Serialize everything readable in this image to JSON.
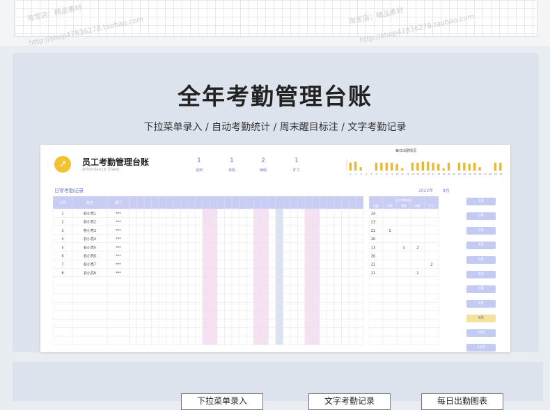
{
  "banner": {
    "title": "全年考勤管理台账",
    "subtitle": "下拉菜单录入 / 自动考勤统计 / 周末醒目标注 / 文字考勤记录"
  },
  "watermarks": [
    "淘宝店：精品素材",
    "http://shop47836278.taobao.com"
  ],
  "sheet": {
    "title": "员工考勤管理台账",
    "subtitle": "Attendance Sheet",
    "stats": [
      {
        "value": "1",
        "label": "迟到"
      },
      {
        "value": "1",
        "label": "事假"
      },
      {
        "value": "2",
        "label": "病假"
      },
      {
        "value": "1",
        "label": "旷工"
      }
    ],
    "chart_title": "每日出勤情况",
    "section_title": "日常考勤记录",
    "year": "2022年",
    "month": "9月",
    "columns": [
      "工号",
      "姓名",
      "部门"
    ],
    "summary_title": "全月考勤统计",
    "summary_cols": [
      "出勤",
      "迟到",
      "事假",
      "病假",
      "旷工"
    ],
    "rows": [
      {
        "id": "1",
        "name": "初小亮1",
        "dept": "***",
        "att": "24",
        "lt": "",
        "sj": "",
        "bj": "",
        "kg": ""
      },
      {
        "id": "2",
        "name": "初小亮2",
        "dept": "***",
        "att": "23",
        "lt": "",
        "sj": "",
        "bj": "",
        "kg": ""
      },
      {
        "id": "3",
        "name": "初小亮3",
        "dept": "***",
        "att": "21",
        "lt": "1",
        "sj": "",
        "bj": "",
        "kg": ""
      },
      {
        "id": "4",
        "name": "初小亮4",
        "dept": "***",
        "att": "20",
        "lt": "",
        "sj": "",
        "bj": "",
        "kg": ""
      },
      {
        "id": "5",
        "name": "初小亮5",
        "dept": "***",
        "att": "13",
        "lt": "",
        "sj": "1",
        "bj": "2",
        "kg": ""
      },
      {
        "id": "6",
        "name": "初小亮6",
        "dept": "***",
        "att": "20",
        "lt": "",
        "sj": "",
        "bj": "",
        "kg": ""
      },
      {
        "id": "7",
        "name": "初小亮7",
        "dept": "***",
        "att": "21",
        "lt": "",
        "sj": "",
        "bj": "",
        "kg": "2"
      },
      {
        "id": "8",
        "name": "初小亮8",
        "dept": "***",
        "att": "21",
        "lt": "",
        "sj": "",
        "bj": "1",
        "kg": ""
      }
    ],
    "months": [
      "1月",
      "2月",
      "3月",
      "4月",
      "5月",
      "6月",
      "7月",
      "8月",
      "9月",
      "10月",
      "11月"
    ],
    "selected_month": "9月"
  },
  "chart_data": {
    "type": "bar",
    "title": "每日出勤情况",
    "categories": [
      "1",
      "2",
      "3",
      "4",
      "5",
      "6",
      "7",
      "8",
      "9",
      "10",
      "11",
      "12",
      "13",
      "14",
      "15",
      "16",
      "17",
      "18",
      "19",
      "20",
      "21",
      "22",
      "23",
      "24",
      "25",
      "26",
      "27",
      "28",
      "29",
      "30"
    ],
    "values": [
      7,
      8,
      3,
      0,
      0,
      7,
      7,
      7,
      7,
      6,
      2,
      0,
      7,
      7,
      8,
      8,
      7,
      6,
      2,
      7,
      0,
      7,
      7,
      6,
      7,
      3,
      0,
      0,
      7,
      7
    ],
    "ylim": [
      0,
      10
    ],
    "colors": {
      "bar": "#e9b82c"
    }
  },
  "buttons": [
    "下拉菜单录入",
    "文字考勤记录",
    "每日出勤图表"
  ]
}
